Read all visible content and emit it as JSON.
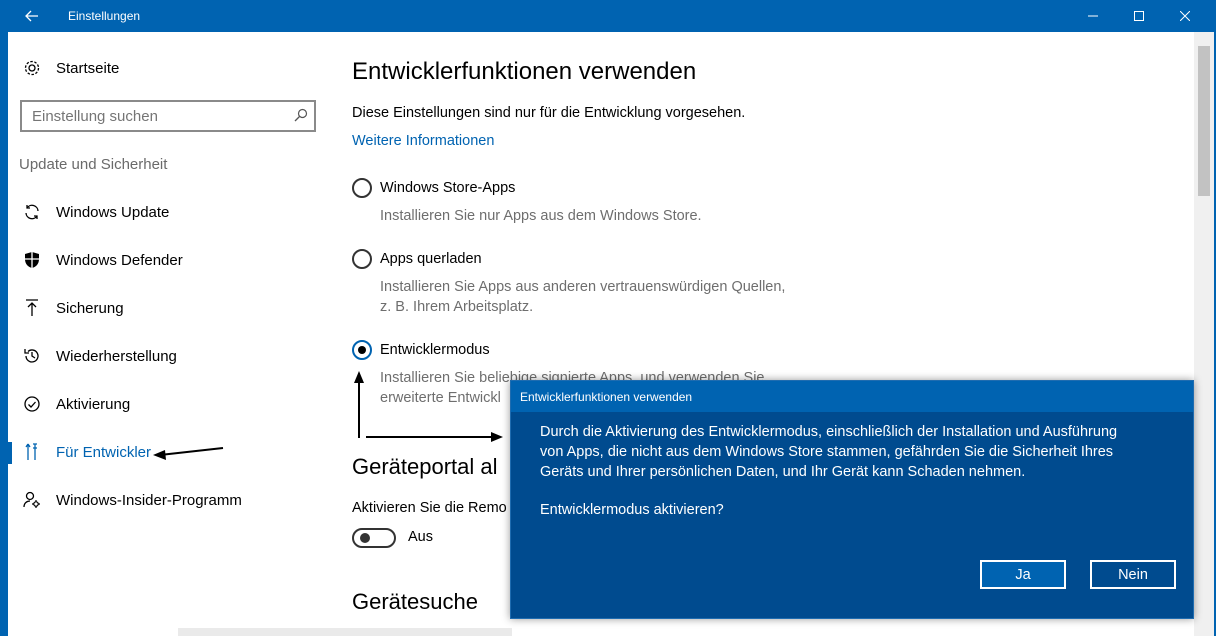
{
  "window": {
    "title": "Einstellungen",
    "controls": [
      "minimize",
      "maximize",
      "close"
    ]
  },
  "sidebar": {
    "home_label": "Startseite",
    "search_placeholder": "Einstellung suchen",
    "section_label": "Update und Sicherheit",
    "items": [
      {
        "label": "Windows Update",
        "icon": "sync-icon"
      },
      {
        "label": "Windows Defender",
        "icon": "shield-icon"
      },
      {
        "label": "Sicherung",
        "icon": "backup-arrow-icon"
      },
      {
        "label": "Wiederherstellung",
        "icon": "history-icon"
      },
      {
        "label": "Aktivierung",
        "icon": "check-circle-icon"
      },
      {
        "label": "Für Entwickler",
        "icon": "developer-tools-icon",
        "active": true
      },
      {
        "label": "Windows-Insider-Programm",
        "icon": "insider-icon"
      }
    ]
  },
  "main": {
    "title": "Entwicklerfunktionen verwenden",
    "description": "Diese Einstellungen sind nur für die Entwicklung vorgesehen.",
    "more_info_link": "Weitere Informationen",
    "options": [
      {
        "label": "Windows Store-Apps",
        "desc": [
          "Installieren Sie nur Apps aus dem Windows Store."
        ],
        "selected": false
      },
      {
        "label": "Apps querladen",
        "desc": [
          "Installieren Sie Apps aus anderen vertrauenswürdigen Quellen,",
          "z. B. Ihrem Arbeitsplatz."
        ],
        "selected": false
      },
      {
        "label": "Entwicklermodus",
        "desc": [
          "Installieren Sie beliebige signierte Apps, und verwenden Sie",
          "erweiterte Entwickl"
        ],
        "selected": true
      }
    ],
    "device_portal_heading": "Geräteportal al",
    "device_portal_desc": "Aktivieren Sie die Remo",
    "toggle_label": "Aus",
    "device_search_heading": "Gerätesuche"
  },
  "dialog": {
    "title": "Entwicklerfunktionen verwenden",
    "body": [
      "Durch die Aktivierung des Entwicklermodus, einschließlich der Installation und Ausführung",
      "von Apps, die nicht aus dem Windows Store stammen, gefährden Sie die Sicherheit Ihres",
      "Geräts und Ihrer persönlichen Daten, und Ihr Gerät kann Schaden nehmen."
    ],
    "question": "Entwicklermodus aktivieren?",
    "yes_label": "Ja",
    "no_label": "Nein"
  },
  "colors": {
    "accent": "#0063b1",
    "dialog_bg": "#004b8f"
  }
}
